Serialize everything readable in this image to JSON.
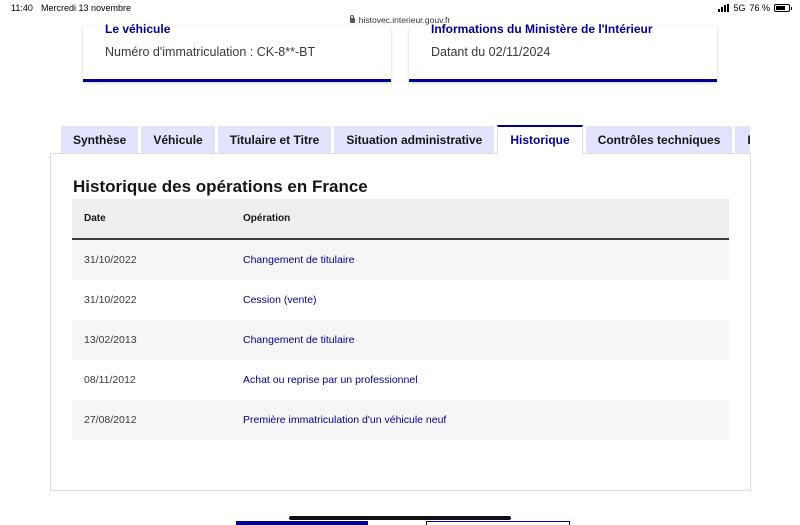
{
  "status_bar": {
    "time": "11:40",
    "date": "Mercredi 13 novembre",
    "url": "histovec.interieur.gouv.fr",
    "network": "5G",
    "battery": "76 %"
  },
  "cards": {
    "left": {
      "title": "Le véhicule",
      "text": "Numéro d'immatriculation : CK-8**-BT"
    },
    "right": {
      "title": "Informations du Ministère de l'Intérieur",
      "text": "Datant du 02/11/2024"
    }
  },
  "tabs": [
    {
      "label": "Synthèse"
    },
    {
      "label": "Véhicule"
    },
    {
      "label": "Titulaire et Titre"
    },
    {
      "label": "Situation administrative"
    },
    {
      "label": "Historique"
    },
    {
      "label": "Contrôles techniques"
    },
    {
      "label": "Kilométrage"
    }
  ],
  "active_tab": "Historique",
  "history": {
    "title": "Historique des opérations en France",
    "columns": {
      "date": "Date",
      "operation": "Opération"
    },
    "rows": [
      {
        "date": "31/10/2022",
        "operation": "Changement de titulaire"
      },
      {
        "date": "31/10/2022",
        "operation": "Cession (vente)"
      },
      {
        "date": "13/02/2013",
        "operation": "Changement de titulaire"
      },
      {
        "date": "08/11/2012",
        "operation": "Achat ou reprise par un professionnel"
      },
      {
        "date": "27/08/2012",
        "operation": "Première immatriculation d'un véhicule neuf"
      }
    ]
  },
  "colors": {
    "accent": "#000091",
    "tab_bg": "#e3e3fd",
    "row_alt": "#f6f6f6"
  }
}
